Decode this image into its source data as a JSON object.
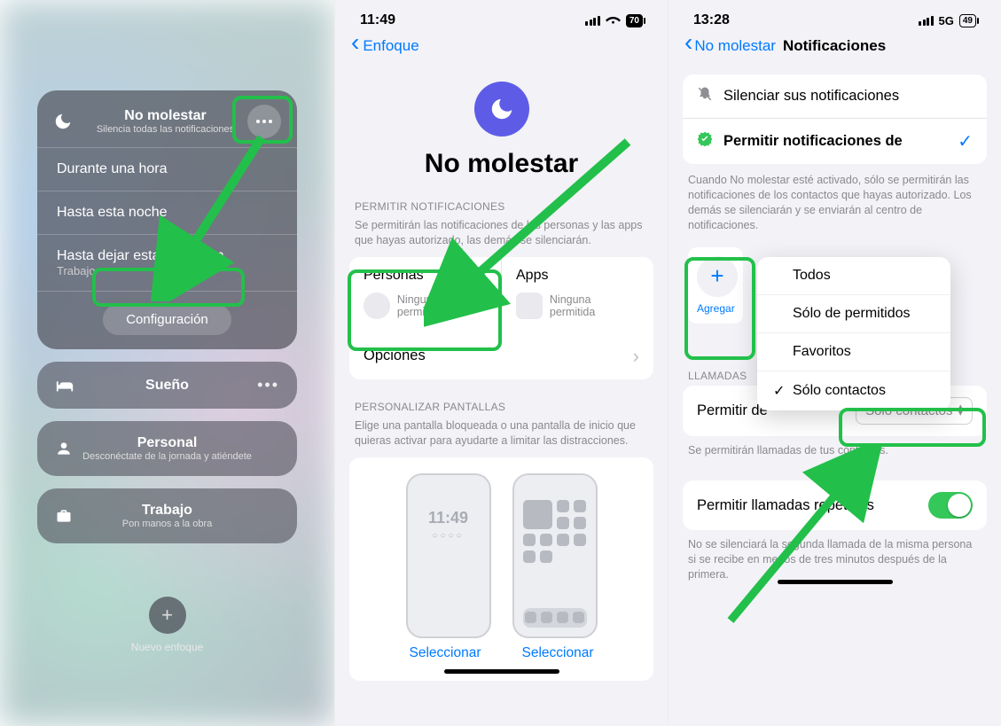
{
  "phone1": {
    "card": {
      "title": "No molestar",
      "subtitle": "Silencia todas las notificaciones",
      "items": [
        {
          "label": "Durante una hora"
        },
        {
          "label": "Hasta esta noche"
        },
        {
          "label": "Hasta dejar esta ubicación",
          "sub": "Trabajo"
        }
      ],
      "config_label": "Configuración"
    },
    "rows": [
      {
        "id": "sleep",
        "title": "Sueño",
        "sub": "",
        "more": "•••"
      },
      {
        "id": "personal",
        "title": "Personal",
        "sub": "Desconéctate de la jornada y atiéndete",
        "more": ""
      },
      {
        "id": "work",
        "title": "Trabajo",
        "sub": "Pon manos a la obra",
        "more": ""
      }
    ],
    "new_label": "Nuevo enfoque"
  },
  "phone2": {
    "status": {
      "time": "11:49",
      "battery": "70"
    },
    "back_label": "Enfoque",
    "title": "No molestar",
    "sec1_title": "PERMITIR NOTIFICACIONES",
    "sec1_desc": "Se permitirán las notificaciones de las personas y las apps que hayas autorizado, las demás se silenciarán.",
    "people": {
      "label": "Personas",
      "note": "Ninguna permitida"
    },
    "apps": {
      "label": "Apps",
      "note": "Ninguna permitida"
    },
    "options_label": "Opciones",
    "sec2_title": "PERSONALIZAR PANTALLAS",
    "sec2_desc": "Elige una pantalla bloqueada o una pantalla de inicio que quieras activar para ayudarte a limitar las distracciones.",
    "mock_time": "11:49",
    "mock_dots": "○○○○",
    "select_label": "Seleccionar"
  },
  "phone3": {
    "status": {
      "time": "13:28",
      "net": "5G",
      "battery": "49"
    },
    "back_label": "No molestar",
    "nav_title": "Notificaciones",
    "row_silence": "Silenciar sus notificaciones",
    "row_allow": "Permitir notificaciones de",
    "desc1": "Cuando No molestar esté activado, sólo se permitirán las notificaciones de los contactos que hayas autorizado. Los demás se silenciarán y se enviarán al centro de notificaciones.",
    "add_label": "Agregar",
    "popover": [
      {
        "label": "Todos",
        "checked": false
      },
      {
        "label": "Sólo de permitidos",
        "checked": false
      },
      {
        "label": "Favoritos",
        "checked": false
      },
      {
        "label": "Sólo contactos",
        "checked": true
      }
    ],
    "calls_header": "LLAMADAS",
    "allow_from_label": "Permitir de",
    "allow_from_value": "Sólo contactos",
    "desc2": "Se permitirán llamadas de tus contactos.",
    "repeat_label": "Permitir llamadas repetidas",
    "desc3": "No se silenciará la segunda llamada de la misma persona si se recibe en menos de tres minutos después de la primera."
  }
}
